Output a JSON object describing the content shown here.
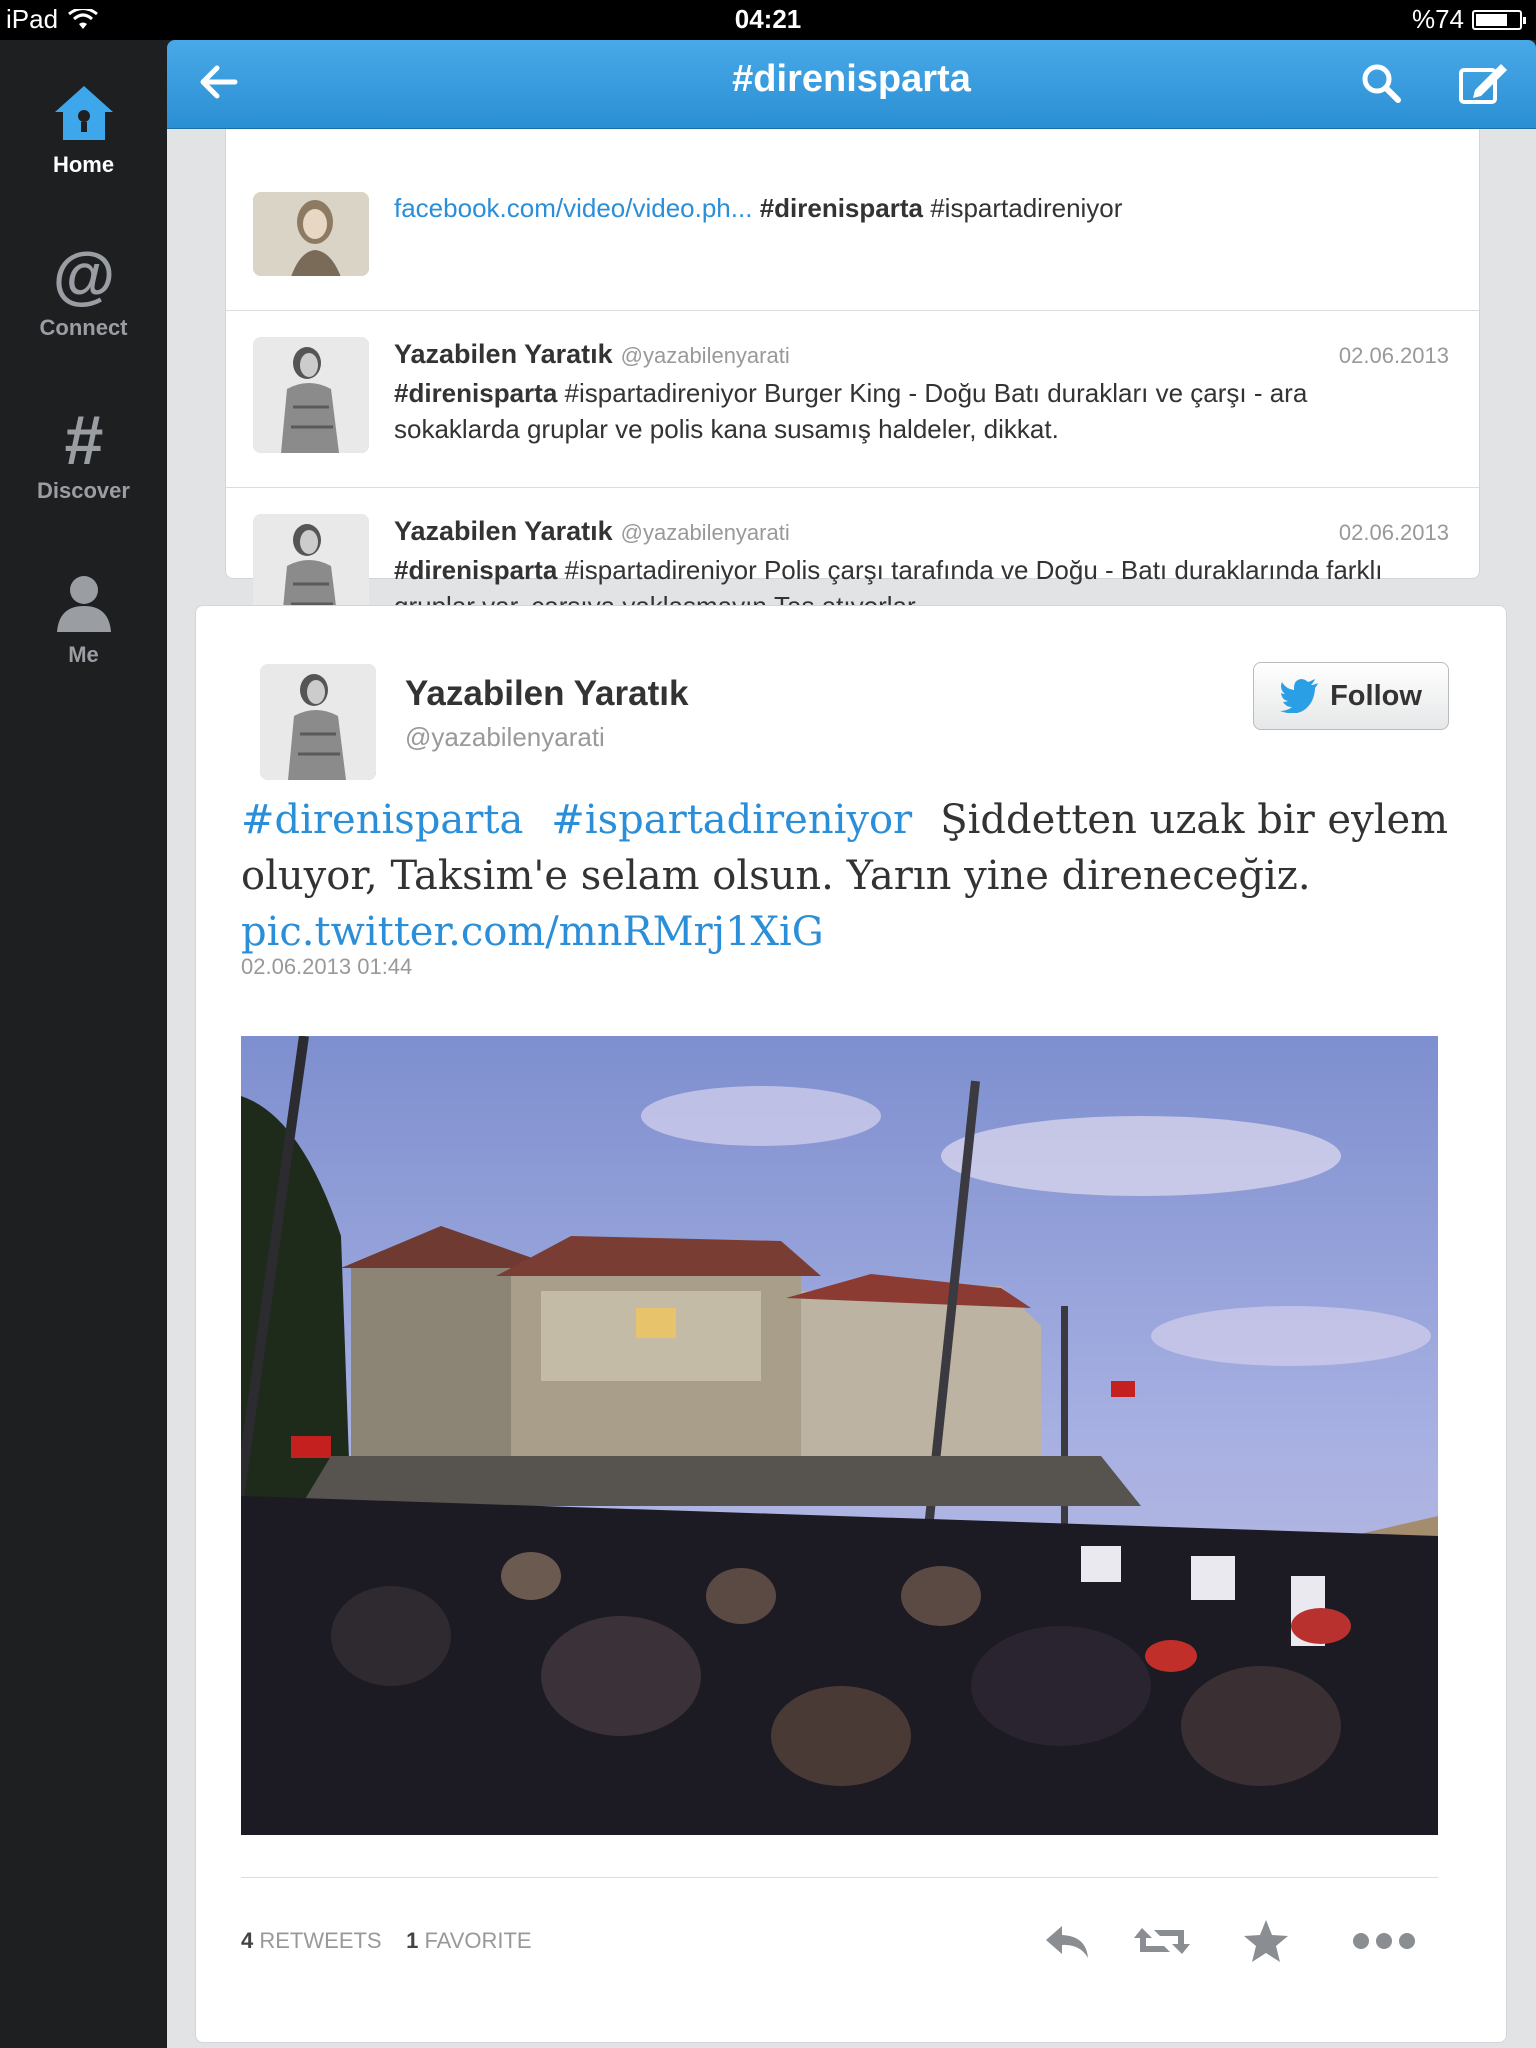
{
  "status_bar": {
    "device": "iPad",
    "time": "04:21",
    "battery": "%74",
    "battery_level": 0.74
  },
  "sidebar": {
    "items": [
      {
        "label": "Home",
        "icon": "home-icon",
        "active": true
      },
      {
        "label": "Connect",
        "icon": "at-icon",
        "active": false
      },
      {
        "label": "Discover",
        "icon": "hash-icon",
        "active": false
      },
      {
        "label": "Me",
        "icon": "person-icon",
        "active": false
      }
    ]
  },
  "header": {
    "title": "#direnisparta",
    "back_icon": "back-arrow-icon",
    "search_icon": "search-icon",
    "compose_icon": "compose-icon"
  },
  "timeline": {
    "partial_tweet": {
      "link": "facebook.com/video/video.ph...",
      "hashtag_bold": "#direnisparta",
      "hashtag": "#ispartadireniyor"
    },
    "tweets": [
      {
        "name": "Yazabilen Yaratık",
        "handle": "@yazabilenyarati",
        "date": "02.06.2013",
        "bold_tag": "#direnisparta",
        "text": " #ispartadireniyor Burger King - Doğu Batı durakları ve çarşı - ara sokaklarda gruplar ve polis kana susamış haldeler, dikkat."
      },
      {
        "name": "Yazabilen Yaratık",
        "handle": "@yazabilenyarati",
        "date": "02.06.2013",
        "bold_tag": "#direnisparta",
        "text": " #ispartadireniyor Polis çarşı tarafında ve Doğu - Batı duraklarında farklı gruplar var, çarşıya yaklaşmayın.Taş atıyorlar."
      }
    ]
  },
  "detail": {
    "name": "Yazabilen Yaratık",
    "handle": "@yazabilenyarati",
    "follow_label": "Follow",
    "tag1": "#direnisparta",
    "tag2": "#ispartadireniyor",
    "text_line1": "Şiddetten uzak bir eylem",
    "text_line2": "oluyor, Taksim'e selam olsun. Yarın yine direneceğiz.",
    "link": "pic.twitter.com/mnRMrj1XiG",
    "timestamp": "02.06.2013 01:44",
    "retweets_count": "4",
    "retweets_label": "RETWEETS",
    "favorites_count": "1",
    "favorites_label": "FAVORITE",
    "actions": [
      "reply-icon",
      "retweet-icon",
      "favorite-star-icon",
      "more-icon"
    ]
  },
  "colors": {
    "accent": "#2b8ed8",
    "header": "#3a9de0",
    "sidebar": "#1d1f21",
    "background": "#e2e3e4"
  }
}
